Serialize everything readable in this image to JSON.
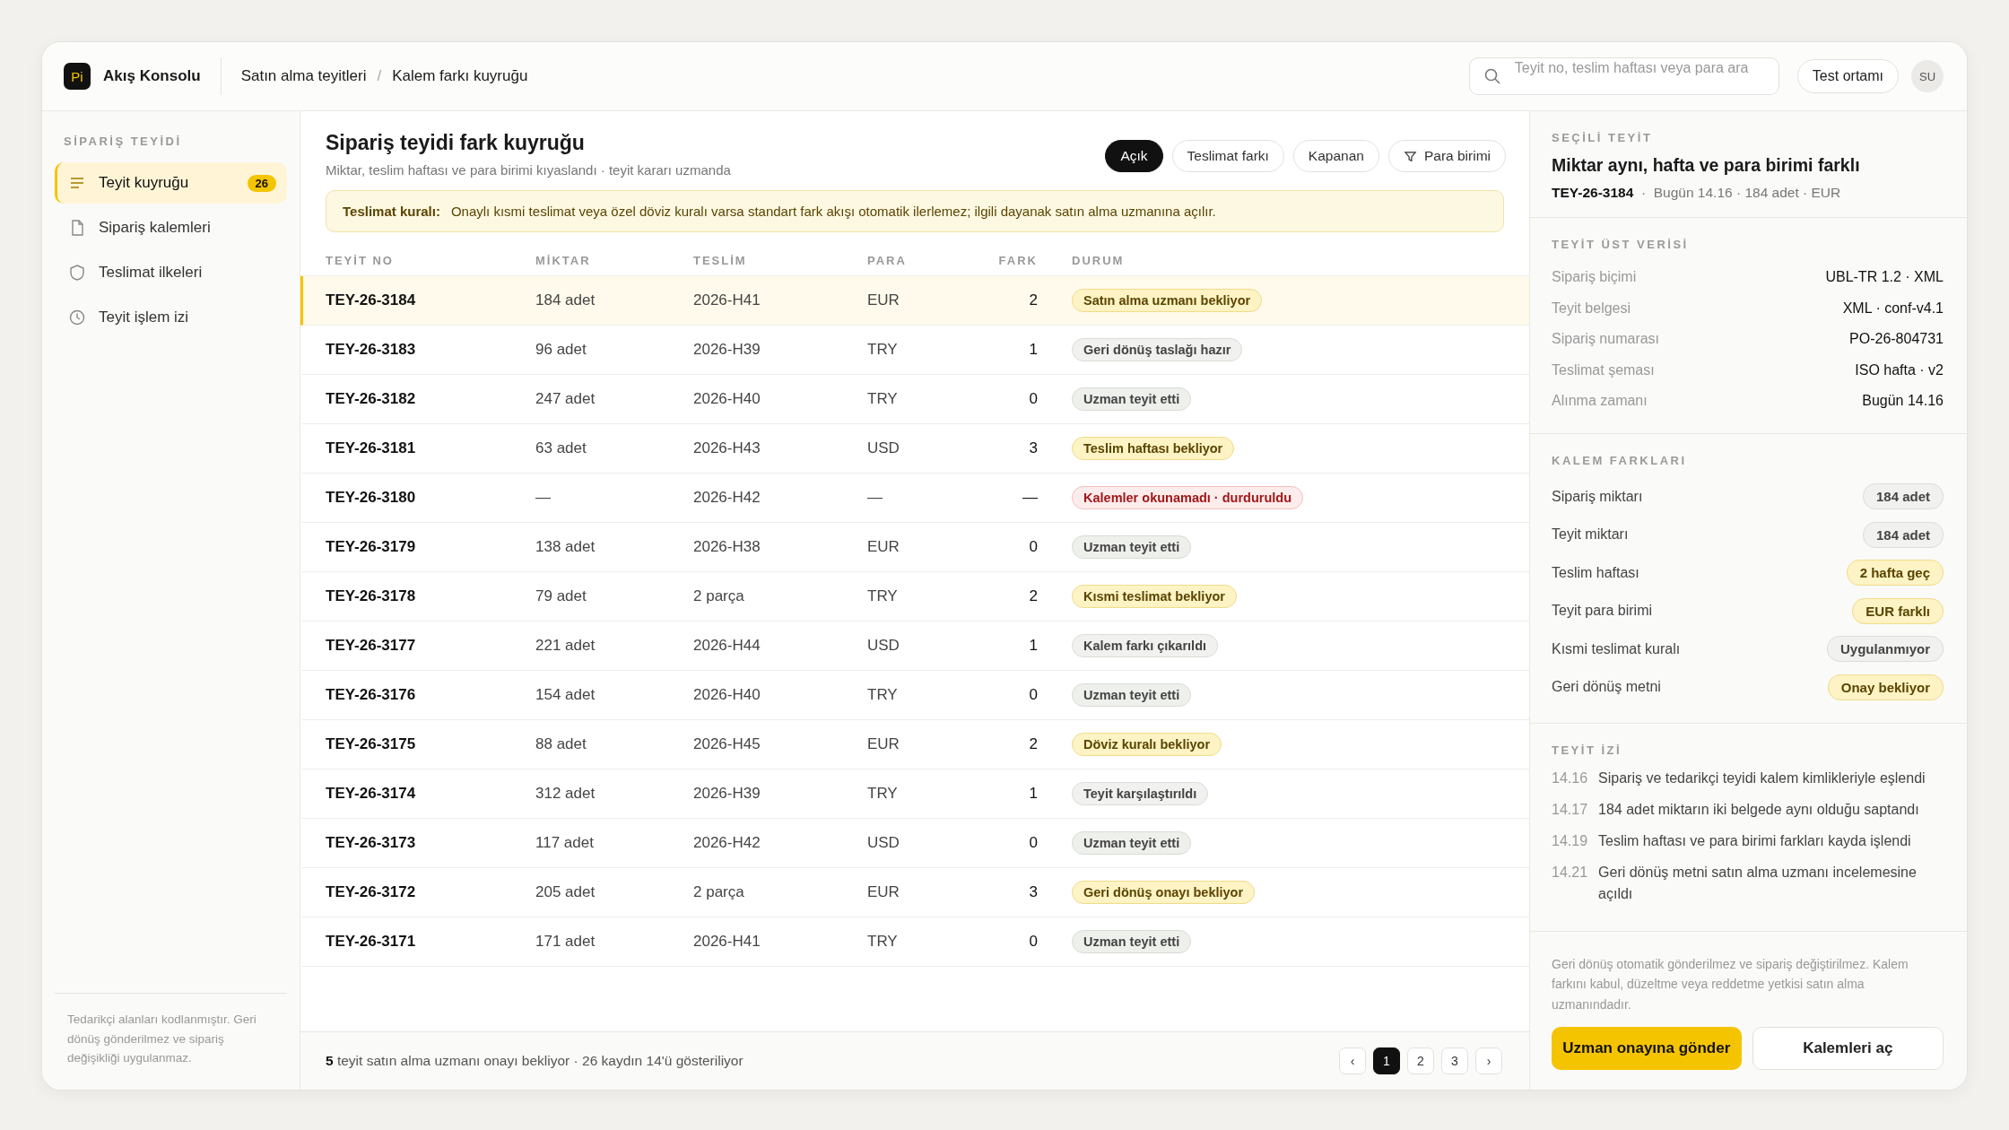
{
  "app": {
    "logo": "Pi",
    "name": "Akış Konsolu"
  },
  "breadcrumb": [
    "Satın alma teyitleri",
    "Kalem farkı kuyruğu"
  ],
  "breadcrumb_separator": "/",
  "search": {
    "placeholder": "Teyit no, teslim haftası veya para ara"
  },
  "env_button": "Test ortamı",
  "avatar": "SU",
  "sidebar": {
    "heading": "SİPARİŞ TEYİDİ",
    "items": [
      {
        "label": "Teyit kuyruğu",
        "badge": "26",
        "selected": true
      },
      {
        "label": "Sipariş kalemleri",
        "selected": false
      },
      {
        "label": "Teslimat ilkeleri",
        "selected": false
      },
      {
        "label": "Teyit işlem izi",
        "selected": false
      }
    ],
    "note": "Tedarikçi alanları kodlanmıştır. Geri dönüş gönderilmez ve sipariş değişikliği uygulanmaz."
  },
  "main": {
    "title": "Sipariş teyidi fark kuyruğu",
    "subtitle": "Miktar, teslim haftası ve para birimi kıyaslandı · teyit kararı uzmanda",
    "filters": [
      {
        "label": "Açık",
        "selected": true
      },
      {
        "label": "Teslimat farkı",
        "selected": false
      },
      {
        "label": "Kapanan",
        "selected": false
      },
      {
        "label": "Para birimi",
        "selected": false
      }
    ],
    "rule": {
      "label": "Teslimat kuralı:",
      "text": "Onaylı kısmi teslimat veya özel döviz kuralı varsa standart fark akışı otomatik ilerlemez; ilgili dayanak satın alma uzmanına açılır."
    },
    "table": {
      "columns": [
        "TEYİT NO",
        "MİKTAR",
        "TESLİM",
        "PARA",
        "FARK",
        "DURUM"
      ],
      "rows": [
        {
          "id": "TEY-26-3184",
          "qty": "184 adet",
          "week": "2026-H41",
          "cur": "EUR",
          "diff": "2",
          "status": "Satın alma uzmanı bekliyor",
          "kind": "warn",
          "selected": true
        },
        {
          "id": "TEY-26-3183",
          "qty": "96 adet",
          "week": "2026-H39",
          "cur": "TRY",
          "diff": "1",
          "status": "Geri dönüş taslağı hazır",
          "kind": "neutral",
          "selected": false
        },
        {
          "id": "TEY-26-3182",
          "qty": "247 adet",
          "week": "2026-H40",
          "cur": "TRY",
          "diff": "0",
          "status": "Uzman teyit etti",
          "kind": "ok",
          "selected": false
        },
        {
          "id": "TEY-26-3181",
          "qty": "63 adet",
          "week": "2026-H43",
          "cur": "USD",
          "diff": "3",
          "status": "Teslim haftası bekliyor",
          "kind": "warn",
          "selected": false
        },
        {
          "id": "TEY-26-3180",
          "qty": "—",
          "week": "2026-H42",
          "cur": "—",
          "diff": "—",
          "status": "Kalemler okunamadı · durduruldu",
          "kind": "error",
          "selected": false
        },
        {
          "id": "TEY-26-3179",
          "qty": "138 adet",
          "week": "2026-H38",
          "cur": "EUR",
          "diff": "0",
          "status": "Uzman teyit etti",
          "kind": "ok",
          "selected": false
        },
        {
          "id": "TEY-26-3178",
          "qty": "79 adet",
          "week": "2 parça",
          "cur": "TRY",
          "diff": "2",
          "status": "Kısmi teslimat bekliyor",
          "kind": "warn",
          "selected": false
        },
        {
          "id": "TEY-26-3177",
          "qty": "221 adet",
          "week": "2026-H44",
          "cur": "USD",
          "diff": "1",
          "status": "Kalem farkı çıkarıldı",
          "kind": "neutral",
          "selected": false
        },
        {
          "id": "TEY-26-3176",
          "qty": "154 adet",
          "week": "2026-H40",
          "cur": "TRY",
          "diff": "0",
          "status": "Uzman teyit etti",
          "kind": "ok",
          "selected": false
        },
        {
          "id": "TEY-26-3175",
          "qty": "88 adet",
          "week": "2026-H45",
          "cur": "EUR",
          "diff": "2",
          "status": "Döviz kuralı bekliyor",
          "kind": "warn",
          "selected": false
        },
        {
          "id": "TEY-26-3174",
          "qty": "312 adet",
          "week": "2026-H39",
          "cur": "TRY",
          "diff": "1",
          "status": "Teyit karşılaştırıldı",
          "kind": "neutral",
          "selected": false
        },
        {
          "id": "TEY-26-3173",
          "qty": "117 adet",
          "week": "2026-H42",
          "cur": "USD",
          "diff": "0",
          "status": "Uzman teyit etti",
          "kind": "ok",
          "selected": false
        },
        {
          "id": "TEY-26-3172",
          "qty": "205 adet",
          "week": "2 parça",
          "cur": "EUR",
          "diff": "3",
          "status": "Geri dönüş onayı bekliyor",
          "kind": "warn",
          "selected": false
        },
        {
          "id": "TEY-26-3171",
          "qty": "171 adet",
          "week": "2026-H41",
          "cur": "TRY",
          "diff": "0",
          "status": "Uzman teyit etti",
          "kind": "ok",
          "selected": false
        }
      ]
    },
    "footer": "**5** teyit satın alma uzmanı onayı bekliyor · 26 kaydın 14'ü gösteriliyor",
    "pagination": {
      "prev": "‹",
      "next": "›",
      "pages": [
        {
          "label": "1",
          "selected": true
        },
        {
          "label": "2",
          "selected": false
        },
        {
          "label": "3",
          "selected": false
        }
      ]
    }
  },
  "detail": {
    "heading": "SEÇİLİ TEYİT",
    "title": "Miktar aynı, hafta ve para birimi farklı",
    "meta": "**TEY-26-3184**  ·  Bugün 14.16 · 184 adet · EUR",
    "metadata": {
      "heading": "TEYİT ÜST VERİSİ",
      "rows": [
        {
          "label": "Sipariş biçimi",
          "value": "UBL-TR 1.2 · XML"
        },
        {
          "label": "Teyit belgesi",
          "value": "XML · conf-v4.1"
        },
        {
          "label": "Sipariş numarası",
          "value": "PO-26-804731"
        },
        {
          "label": "Teslimat şeması",
          "value": "ISO hafta · v2"
        },
        {
          "label": "Alınma zamanı",
          "value": "Bugün 14.16"
        }
      ]
    },
    "differences": {
      "heading": "KALEM FARKLARI",
      "rows": [
        {
          "label": "Sipariş miktarı",
          "value": "184 adet",
          "kind": "neutral"
        },
        {
          "label": "Teyit miktarı",
          "value": "184 adet",
          "kind": "neutral"
        },
        {
          "label": "Teslim haftası",
          "value": "2 hafta geç",
          "kind": "warn"
        },
        {
          "label": "Teyit para birimi",
          "value": "EUR farklı",
          "kind": "warn"
        },
        {
          "label": "Kısmi teslimat kuralı",
          "value": "Uygulanmıyor",
          "kind": "neutral"
        },
        {
          "label": "Geri dönüş metni",
          "value": "Onay bekliyor",
          "kind": "warn"
        }
      ]
    },
    "trail": {
      "heading": "TEYİT İZİ",
      "events": [
        {
          "time": "14.16",
          "text": "Sipariş ve tedarikçi teyidi kalem kimlikleriyle eşlendi"
        },
        {
          "time": "14.17",
          "text": "184 adet miktarın iki belgede aynı olduğu saptandı"
        },
        {
          "time": "14.19",
          "text": "Teslim haftası ve para birimi farkları kayda işlendi"
        },
        {
          "time": "14.21",
          "text": "Geri dönüş metni satın alma uzmanı incelemesine açıldı"
        }
      ]
    },
    "note": "Geri dönüş otomatik gönderilmez ve sipariş değiştirilmez. Kalem farkını kabul, düzeltme veya reddetme yetkisi satın alma uzmanındadır.",
    "primary_button": "Uzman onayına gönder",
    "secondary_button": "Kalemleri aç"
  }
}
